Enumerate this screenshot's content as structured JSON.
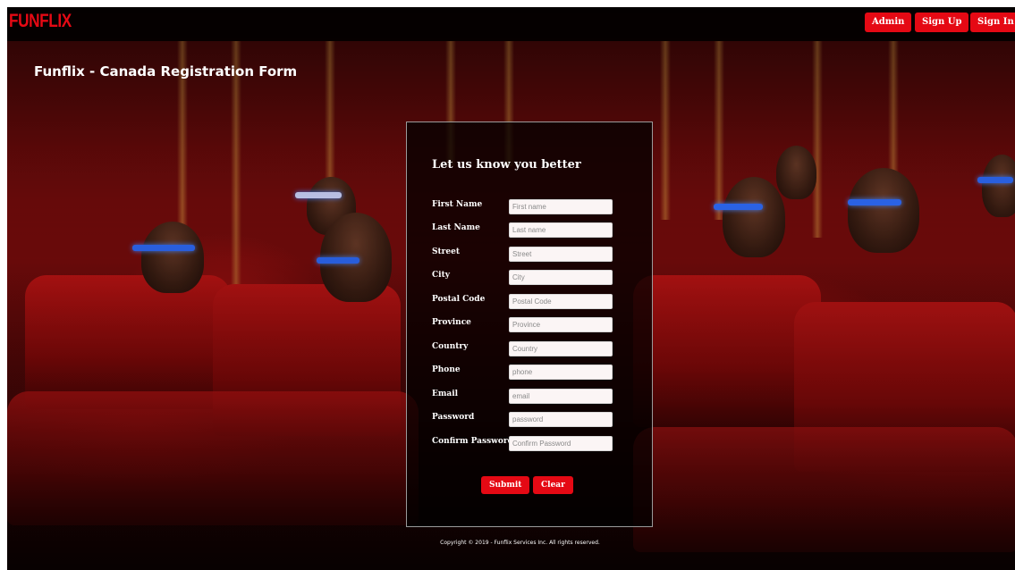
{
  "brand": {
    "logo_text": "FUNFLIX",
    "accent_color": "#e50914"
  },
  "nav": {
    "admin_label": "Admin",
    "signup_label": "Sign Up",
    "signin_label": "Sign In"
  },
  "page": {
    "title": "Funflix - Canada Registration Form"
  },
  "form": {
    "heading": "Let us know you better",
    "fields": [
      {
        "label": "First Name",
        "placeholder": "First name"
      },
      {
        "label": "Last Name",
        "placeholder": "Last name"
      },
      {
        "label": "Street",
        "placeholder": "Street"
      },
      {
        "label": "City",
        "placeholder": "City"
      },
      {
        "label": "Postal Code",
        "placeholder": "Postal Code"
      },
      {
        "label": "Province",
        "placeholder": "Province"
      },
      {
        "label": "Country",
        "placeholder": "Country"
      },
      {
        "label": "Phone",
        "placeholder": "phone"
      },
      {
        "label": "Email",
        "placeholder": "email"
      },
      {
        "label": "Password",
        "placeholder": "password"
      },
      {
        "label": "Confirm Password",
        "placeholder": "Confirm Password"
      }
    ],
    "submit_label": "Submit",
    "clear_label": "Clear"
  },
  "footer": {
    "copyright": "Copyright © 2019 - Funflix Services Inc. All rights reserved."
  }
}
